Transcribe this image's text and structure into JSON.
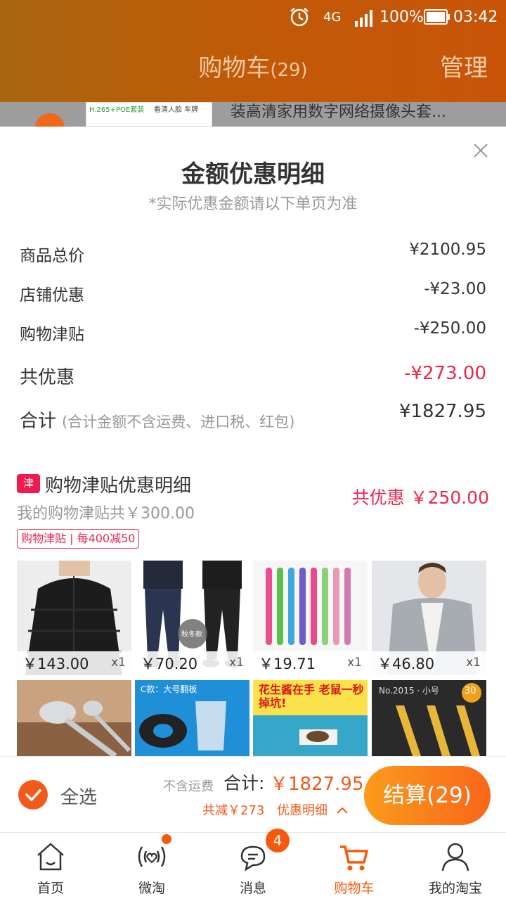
{
  "status_bar": {
    "network": "4G",
    "battery": "100%",
    "time": "03:42"
  },
  "header": {
    "title": "购物车",
    "count": "(29)",
    "manage": "管理"
  },
  "peek_item": {
    "tag1": "H.265+POE套装",
    "tag2": "看清人脸 车牌",
    "text": "装高清家用数字网络摄像头套..."
  },
  "sheet": {
    "title": "金额优惠明细",
    "subtitle": "*实际优惠金额请以下单页为准",
    "rows": [
      {
        "label": "商品总价",
        "value": "¥2100.95"
      },
      {
        "label": "店铺优惠",
        "value": "-¥23.00"
      },
      {
        "label": "购物津贴",
        "value": "-¥250.00"
      }
    ],
    "total_discount": {
      "label": "共优惠",
      "value": "-¥273.00"
    },
    "total": {
      "label": "合计",
      "note": "(合计金额不含运费、进口税、红包)",
      "value": "¥1827.95"
    }
  },
  "jintie": {
    "icon": "津",
    "title": "购物津贴优惠明细",
    "subtitle": "我的购物津贴共￥300.00",
    "saved": "共优惠 ￥250.00",
    "tag": "购物津贴 | 每400减50",
    "products": [
      {
        "price": "￥143.00",
        "qty": "x1"
      },
      {
        "price": "￥70.20",
        "qty": "x1",
        "overlay": "秋冬款"
      },
      {
        "price": "￥19.71",
        "qty": "x1"
      },
      {
        "price": "￥46.80",
        "qty": "x1"
      },
      {
        "price": "",
        "qty": ""
      },
      {
        "price": "",
        "qty": "",
        "overlay": "C款：大号翻板"
      },
      {
        "price": "",
        "qty": "",
        "overlay": "花生酱在手 老鼠一秒掉坑!"
      },
      {
        "price": "",
        "qty": "",
        "overlay": "No.2015 · 小号",
        "badge": "30"
      }
    ]
  },
  "bottom": {
    "select_all": "全选",
    "ex_shipping": "不含运费",
    "sum_label": "合计:",
    "sum_value": "￥1827.95",
    "reduce": "共减￥273",
    "detail": "优惠明细",
    "checkout": "结算(29)"
  },
  "tabs": [
    {
      "label": "首页",
      "icon": "home-icon"
    },
    {
      "label": "微淘",
      "icon": "weitao-icon"
    },
    {
      "label": "消息",
      "icon": "message-icon",
      "badge": "4"
    },
    {
      "label": "购物车",
      "icon": "cart-icon"
    },
    {
      "label": "我的淘宝",
      "icon": "profile-icon"
    }
  ],
  "colors": {
    "accent": "#f55a0c",
    "discount": "#e8294a",
    "header": "#c15a08"
  }
}
